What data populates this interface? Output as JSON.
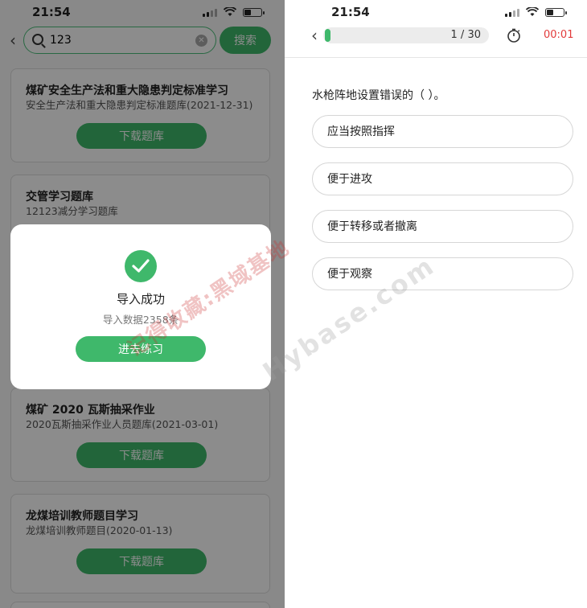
{
  "left": {
    "status_time": "21:54",
    "search": {
      "value": "123",
      "button": "搜索"
    },
    "cards": [
      {
        "title": "煤矿安全生产法和重大隐患判定标准学习",
        "sub": "安全生产法和重大隐患判定标准题库(2021-12-31)",
        "button": "下载题库"
      },
      {
        "title": "交管学习题库",
        "sub": "12123减分学习题库",
        "button": ""
      },
      {
        "title": "煤矿 2020 瓦斯抽采作业",
        "sub": "2020瓦斯抽采作业人员题库(2021-03-01)",
        "button": "下载题库"
      },
      {
        "title": "龙煤培训教师题目学习",
        "sub": "龙煤培训教师题目(2020-01-13)",
        "button": "下载题库"
      }
    ],
    "modal": {
      "title": "导入成功",
      "subtitle": "导入数据2358条",
      "button": "进去练习"
    }
  },
  "right": {
    "status_time": "21:54",
    "progress": {
      "text": "1 / 30",
      "fraction": 0.033
    },
    "timer": "00:01",
    "question": "水枪阵地设置错误的（ ）。",
    "options": [
      "应当按照指挥",
      "便于进攻",
      "便于转移或者撤离",
      "便于观察"
    ]
  },
  "watermark": {
    "text": "记得收藏:黑域基地",
    "text2": "Hybase.com"
  },
  "colors": {
    "accent": "#3fb86b",
    "timer": "#e23b3b"
  },
  "icons": [
    "back-chevron-icon",
    "search-icon",
    "clear-icon",
    "check-icon",
    "stopwatch-icon",
    "signal-icon",
    "wifi-icon",
    "battery-icon"
  ]
}
